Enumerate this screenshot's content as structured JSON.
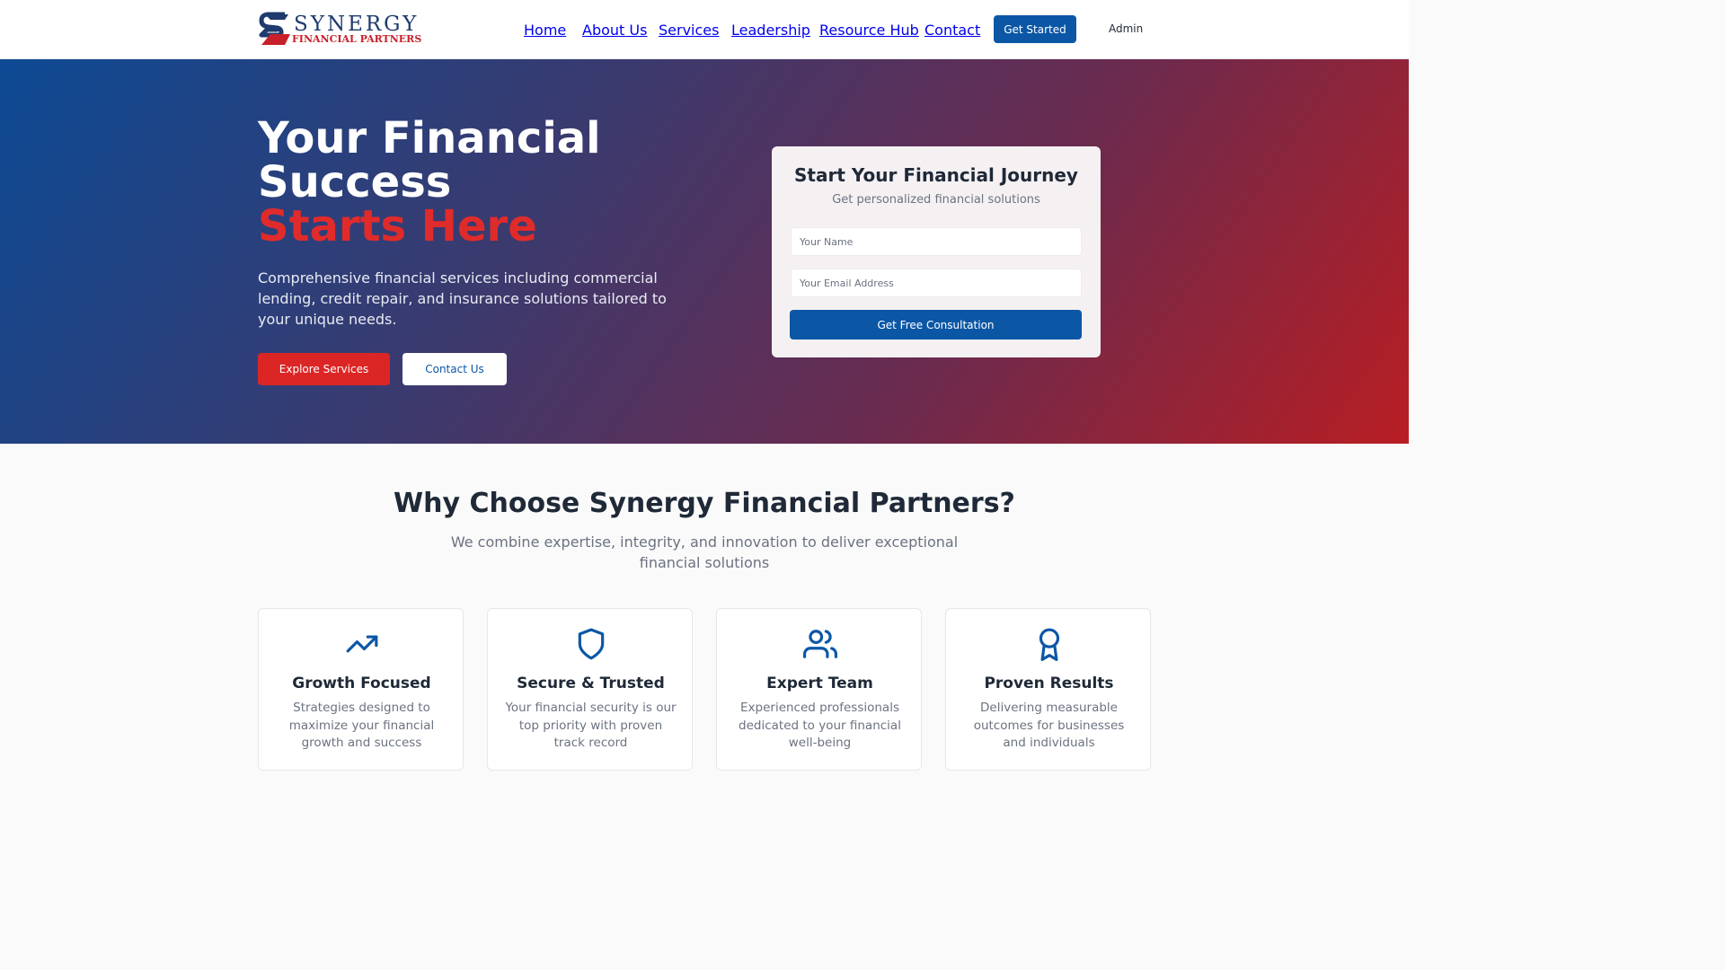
{
  "colors": {
    "primary": "#0b57a6",
    "accent": "#dc2626",
    "heading": "#1f2937",
    "muted": "#6b7280"
  },
  "logo": {
    "title": "SYNERGY",
    "subtitle": "FINANCIAL PARTNERS",
    "mark_letter": "S"
  },
  "nav": {
    "items": [
      {
        "label": "Home",
        "active": true
      },
      {
        "label": "About Us"
      },
      {
        "label": "Services"
      },
      {
        "label": "Leadership"
      },
      {
        "label": "Resource Hub"
      },
      {
        "label": "Contact"
      }
    ],
    "cta_label": "Get Started",
    "admin_label": "Admin"
  },
  "hero": {
    "title_line1": "Your Financial",
    "title_line2": "Success",
    "title_highlight": "Starts Here",
    "description": "Comprehensive financial services including commercial lending, credit repair, and insurance solutions tailored to your unique needs.",
    "explore_label": "Explore Services",
    "contact_label": "Contact Us"
  },
  "form": {
    "title": "Start Your Financial Journey",
    "subtitle": "Get personalized financial solutions",
    "name_placeholder": "Your Name",
    "email_placeholder": "Your Email Address",
    "submit_label": "Get Free Consultation"
  },
  "features": {
    "title": "Why Choose Synergy Financial Partners?",
    "subtitle": "We combine expertise, integrity, and innovation to deliver exceptional financial solutions",
    "cards": [
      {
        "icon": "trending-up-icon",
        "title": "Growth Focused",
        "description": "Strategies designed to maximize your financial growth and success"
      },
      {
        "icon": "shield-icon",
        "title": "Secure & Trusted",
        "description": "Your financial security is our top priority with proven track record"
      },
      {
        "icon": "users-icon",
        "title": "Expert Team",
        "description": "Experienced professionals dedicated to your financial well-being"
      },
      {
        "icon": "award-icon",
        "title": "Proven Results",
        "description": "Delivering measurable outcomes for businesses and individuals"
      }
    ]
  }
}
